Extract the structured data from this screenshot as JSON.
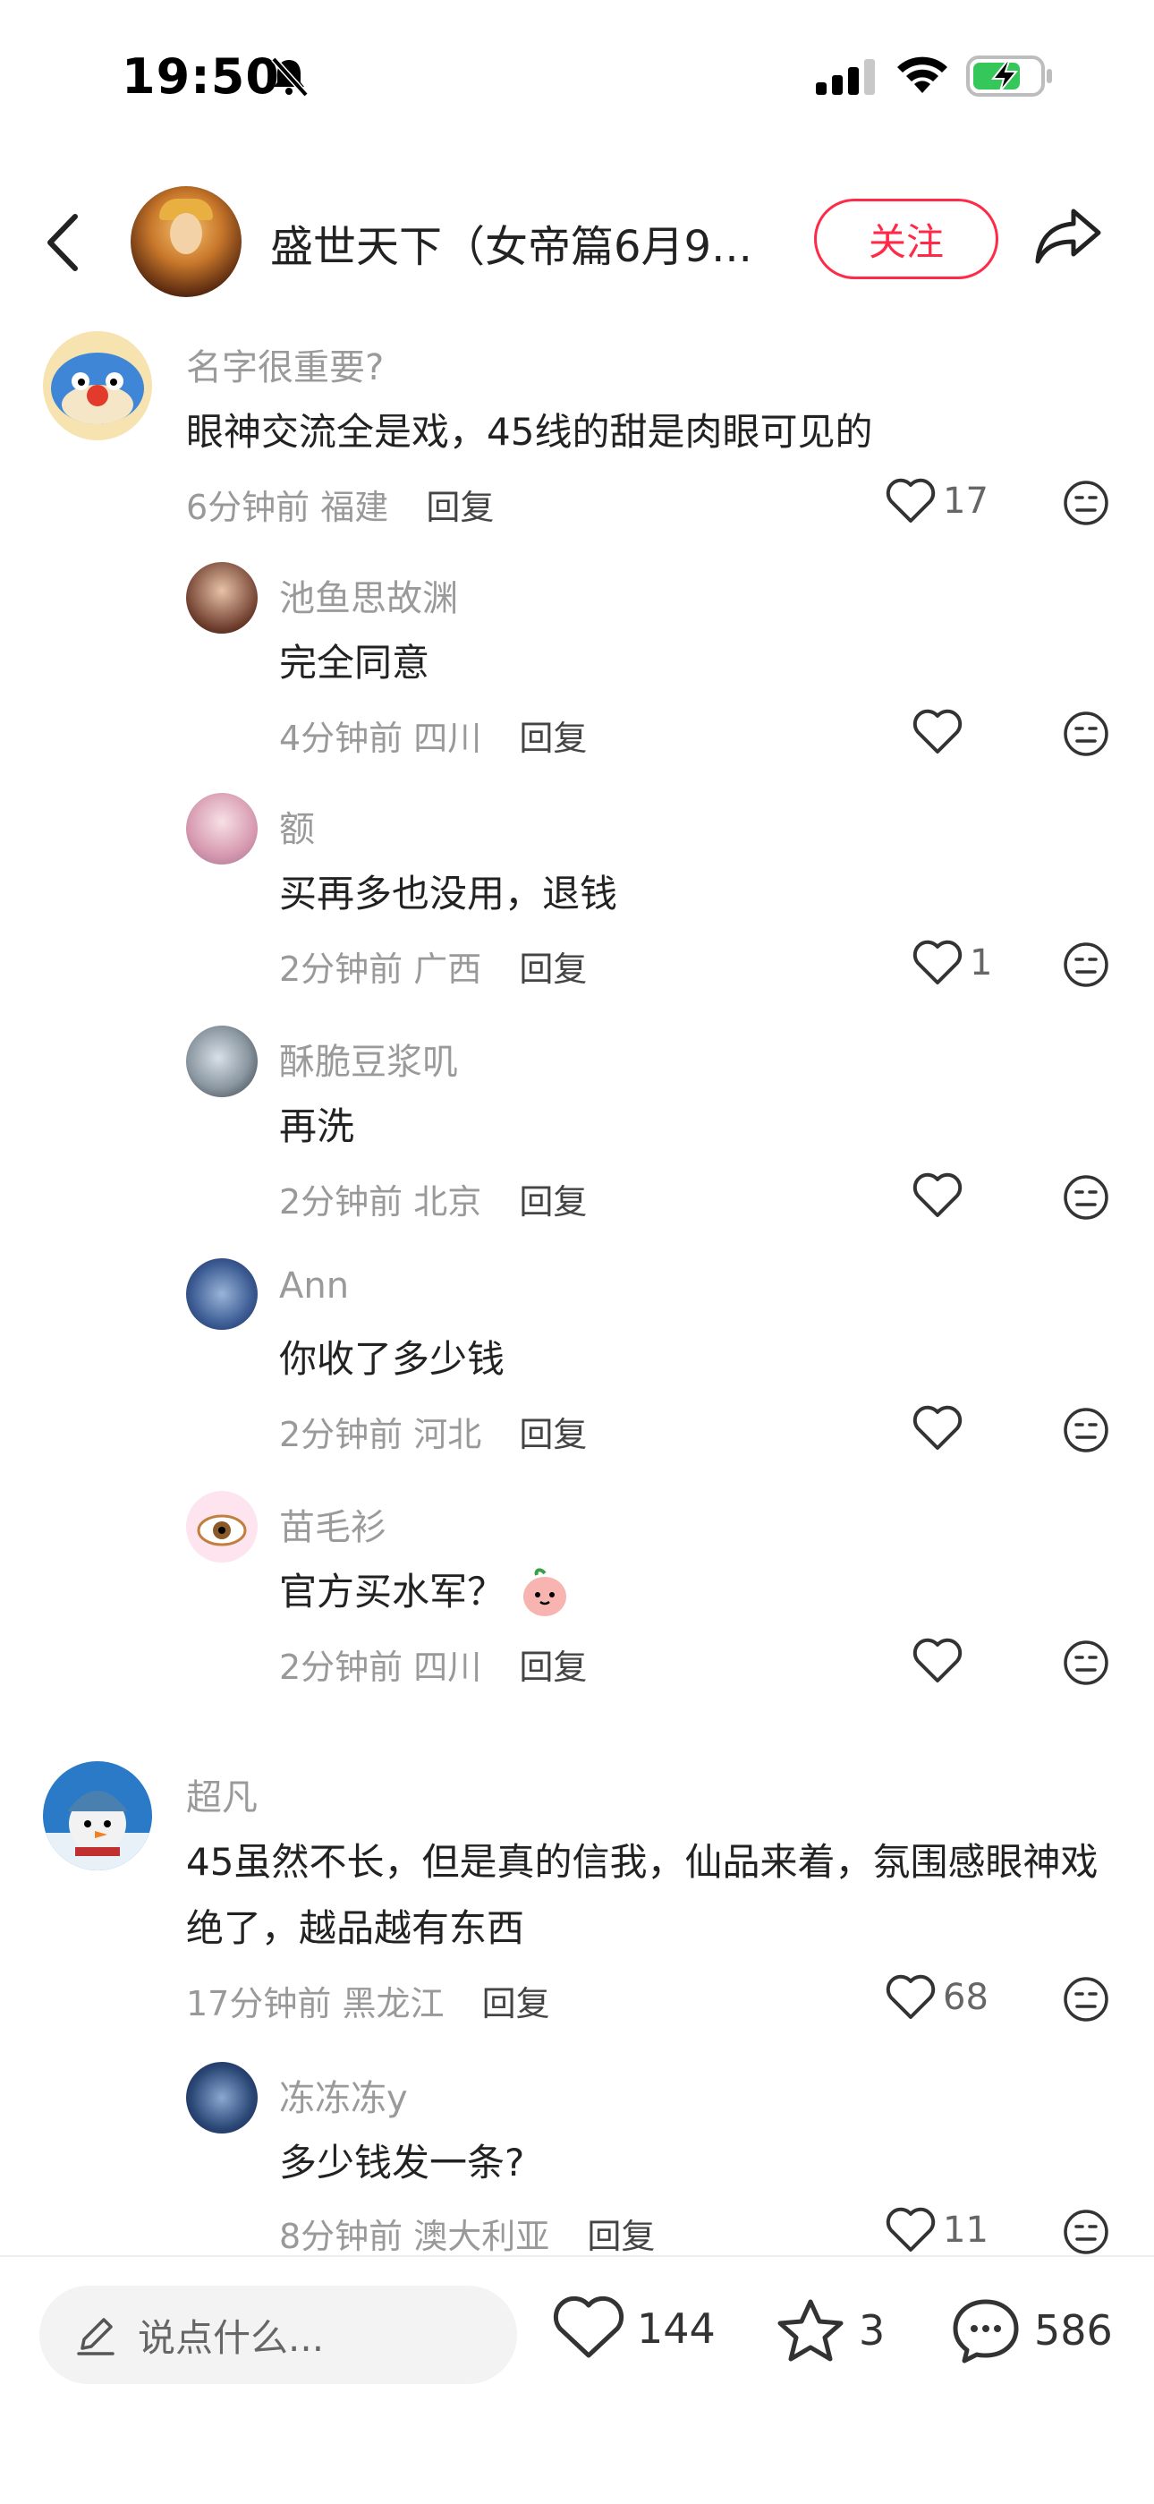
{
  "status_bar": {
    "time": "19:50"
  },
  "header": {
    "title": "盛世天下（女帝篇6月9...",
    "follow_label": "关注"
  },
  "comments": [
    {
      "name": "名字很重要?",
      "text": "眼神交流全是戏，45线的甜是肉眼可见的",
      "time": "6分钟前",
      "location": "福建",
      "reply": "回复",
      "likes": "17"
    },
    {
      "name": "池鱼思故渊",
      "text": "完全同意",
      "time": "4分钟前",
      "location": "四川",
      "reply": "回复",
      "likes": ""
    },
    {
      "name": "额",
      "text": "买再多也没用，退钱",
      "time": "2分钟前",
      "location": "广西",
      "reply": "回复",
      "likes": "1"
    },
    {
      "name": "酥脆豆浆叽",
      "text": "再洗",
      "time": "2分钟前",
      "location": "北京",
      "reply": "回复",
      "likes": ""
    },
    {
      "name": "Ann",
      "text": "你收了多少钱",
      "time": "2分钟前",
      "location": "河北",
      "reply": "回复",
      "likes": ""
    },
    {
      "name": "苗毛衫",
      "text": "官方买水军？",
      "time": "2分钟前",
      "location": "四川",
      "reply": "回复",
      "likes": ""
    },
    {
      "name": "超凡",
      "text": "45虽然不长，但是真的信我，仙品来着，氛围感眼神戏绝了，越品越有东西",
      "time": "17分钟前",
      "location": "黑龙江",
      "reply": "回复",
      "likes": "68"
    },
    {
      "name": "冻冻冻y",
      "text": "多少钱发一条?",
      "time": "8分钟前",
      "location": "澳大利亚",
      "reply": "回复",
      "likes": "11"
    }
  ],
  "bottom_bar": {
    "input_placeholder": "说点什么...",
    "likes": "144",
    "stars": "3",
    "comments": "586"
  },
  "colors": {
    "accent": "#ff2a48",
    "secondary_text": "#999999"
  }
}
